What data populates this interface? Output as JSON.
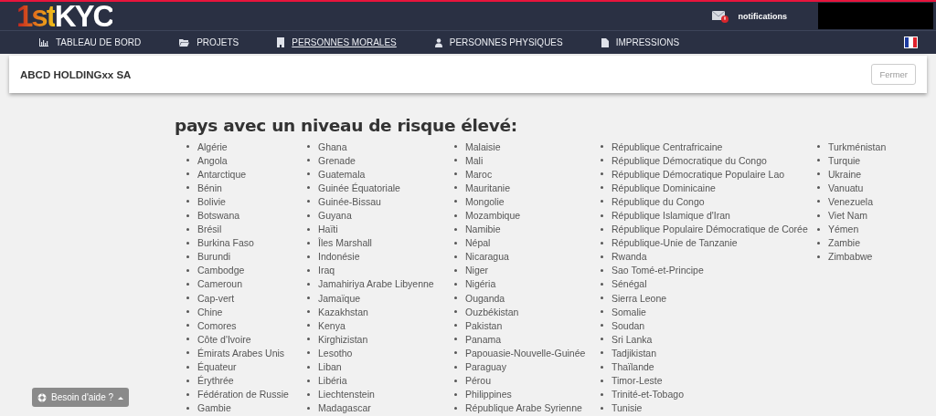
{
  "header": {
    "logo": {
      "part_1": "1st",
      "part_2": "KYC"
    },
    "notifications": {
      "label": "notifications",
      "alert": true
    }
  },
  "nav": [
    {
      "label": "TABLEAU DE BORD",
      "selected": false
    },
    {
      "label": "PROJETS",
      "selected": false
    },
    {
      "label": "PERSONNES MORALES",
      "selected": true
    },
    {
      "label": "PERSONNES PHYSIQUES",
      "selected": false
    },
    {
      "label": "IMPRESSIONS",
      "selected": false
    }
  ],
  "card": {
    "title": "ABCD HOLDINGxx SA",
    "close_button": "Fermer"
  },
  "heading": "pays avec un niveau de risque élevé:",
  "columns": [
    [
      "Algérie",
      "Angola",
      "Antarctique",
      "Bénin",
      "Bolivie",
      "Botswana",
      "Brésil",
      "Burkina Faso",
      "Burundi",
      "Cambodge",
      "Cameroun",
      "Cap-vert",
      "Chine",
      "Comores",
      "Côte d'Ivoire",
      "Émirats Arabes Unis",
      "Équateur",
      "Érythrée",
      "Fédération de Russie",
      "Gambie"
    ],
    [
      "Ghana",
      "Grenade",
      "Guatemala",
      "Guinée Équatoriale",
      "Guinée-Bissau",
      "Guyana",
      "Haïti",
      "Îles Marshall",
      "Indonésie",
      "Iraq",
      "Jamahiriya Arabe Libyenne",
      "Jamaïque",
      "Kazakhstan",
      "Kenya",
      "Kirghizistan",
      "Lesotho",
      "Liban",
      "Libéria",
      "Liechtenstein",
      "Madagascar"
    ],
    [
      "Malaisie",
      "Mali",
      "Maroc",
      "Mauritanie",
      "Mongolie",
      "Mozambique",
      "Namibie",
      "Népal",
      "Nicaragua",
      "Niger",
      "Nigéria",
      "Ouganda",
      "Ouzbékistan",
      "Pakistan",
      "Panama",
      "Papouasie-Nouvelle-Guinée",
      "Paraguay",
      "Pérou",
      "Philippines",
      "République Arabe Syrienne"
    ],
    [
      "République Centrafricaine",
      "République Démocratique du Congo",
      "République Démocratique Populaire Lao",
      "République Dominicaine",
      "République du Congo",
      "République Islamique d'Iran",
      "République Populaire Démocratique de Corée",
      "République-Unie de Tanzanie",
      "Rwanda",
      "Sao Tomé-et-Principe",
      "Sénégal",
      "Sierra Leone",
      "Somalie",
      "Soudan",
      "Sri Lanka",
      "Tadjikistan",
      "Thaïlande",
      "Timor-Leste",
      "Trinité-et-Tobago",
      "Tunisie"
    ],
    [
      "Turkménistan",
      "Turquie",
      "Ukraine",
      "Vanuatu",
      "Venezuela",
      "Viet Nam",
      "Yémen",
      "Zambie",
      "Zimbabwe"
    ]
  ],
  "help_button": "Besoin d'aide ?"
}
